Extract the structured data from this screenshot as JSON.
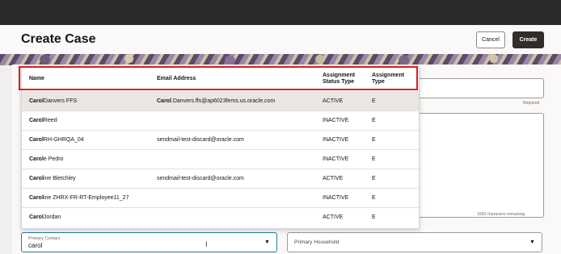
{
  "page": {
    "title": "Create Case"
  },
  "toolbar": {
    "cancel_label": "Cancel",
    "create_label": "Create"
  },
  "form": {
    "required_text": "Required",
    "chars_remaining": "1000 characters remaining",
    "primary_contact": {
      "label": "Primary Contact",
      "value": "carol"
    },
    "primary_household": {
      "label": "Primary Household"
    }
  },
  "dropdown": {
    "columns": {
      "name": "Name",
      "email": "Email Address",
      "status_l1": "Assignment",
      "status_l2": "Status Type",
      "type_l1": "Assignment",
      "type_l2": "Type"
    },
    "rows": [
      {
        "name_match": "Carol",
        "name_rest": " Danvers FFS",
        "email_match": "Carol",
        "email_rest": ".Danvers.ffs@ap6023fems.us.oracle.com",
        "status": "ACTIVE",
        "type": "E"
      },
      {
        "name_match": "Carol",
        "name_rest": " Reed",
        "email_match": "",
        "email_rest": "",
        "status": "INACTIVE",
        "type": "E"
      },
      {
        "name_match": "Carol",
        "name_rest": " RH-GHRQA_04",
        "email_match": "",
        "email_rest": "sendmail-test-discard@oracle.com",
        "status": "INACTIVE",
        "type": "E"
      },
      {
        "name_match": "Carol",
        "name_rest": "e Pedro",
        "email_match": "",
        "email_rest": "",
        "status": "INACTIVE",
        "type": "E"
      },
      {
        "name_match": "Carol",
        "name_rest": "ine Bletchley",
        "email_match": "",
        "email_rest": "sendmail-test-discard@oracle.com",
        "status": "ACTIVE",
        "type": "E"
      },
      {
        "name_match": "Carol",
        "name_rest": "ine ZHRX-FR-RT-Employee11_27",
        "email_match": "",
        "email_rest": "",
        "status": "INACTIVE",
        "type": "E"
      },
      {
        "name_match": "Carol",
        "name_rest": " Jordan",
        "email_match": "",
        "email_rest": "",
        "status": "ACTIVE",
        "type": "E"
      }
    ]
  },
  "icons": {
    "caret": "chevron-down-icon",
    "cursor": "text-cursor-icon"
  },
  "colors": {
    "highlight": "#d81e1e",
    "focus_border": "#227e9e",
    "primary_button": "#312d2a"
  }
}
